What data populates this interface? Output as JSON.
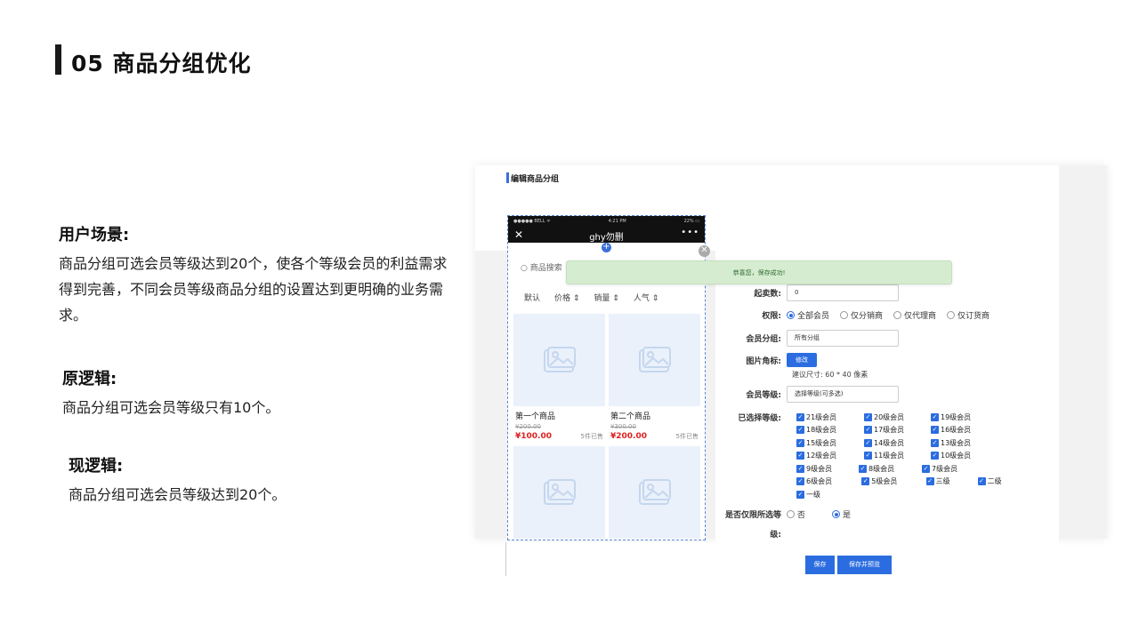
{
  "slide": {
    "title": "05 商品分组优化",
    "scene_heading": "用户场景:",
    "scene_text": "商品分组可选会员等级达到20个，使各个等级会员的利益需求得到完善，不同会员等级商品分组的设置达到更明确的业务需求。",
    "old_heading": "原逻辑:",
    "old_text": "商品分组可选会员等级只有10个。",
    "new_heading": "现逻辑:",
    "new_text": "商品分组可选会员等级达到20个。"
  },
  "panel": {
    "heading": "编辑商品分组",
    "toast": "恭喜您，保存成功!"
  },
  "phone": {
    "status_left": "●●●●● BELL ᯤ",
    "status_time": "4:21 PM",
    "status_right": "22% ▭",
    "nav_title": "ghy勿删",
    "close_glyph": "✕",
    "more_glyph": "•••",
    "search_placeholder": "商品搜索",
    "sort": [
      {
        "label": "默认"
      },
      {
        "label": "价格 ⇕"
      },
      {
        "label": "销量 ⇕"
      },
      {
        "label": "人气 ⇕"
      }
    ],
    "goods": [
      {
        "name": "第一个商品",
        "old_price": "¥200.00",
        "price": "¥100.00",
        "sold": "5件已售"
      },
      {
        "name": "第二个商品",
        "old_price": "¥300.00",
        "price": "¥200.00",
        "sold": "5件已售"
      }
    ]
  },
  "form": {
    "start_qty_label": "起卖数:",
    "start_qty_value": "0",
    "permission_label": "权限:",
    "permission_options": [
      "全部会员",
      "仅分销商",
      "仅代理商",
      "仅订货商"
    ],
    "permission_selected": "全部会员",
    "member_group_label": "会员分组:",
    "member_group_value": "所有分组",
    "badge_label": "图片角标:",
    "badge_button": "修改",
    "badge_hint": "建议尺寸: 60 * 40 像素",
    "member_level_label": "会员等级:",
    "member_level_value": "选择等级(可多选)",
    "selected_levels_label": "已选择等级:",
    "selected_levels": [
      [
        "21级会员",
        "20级会员",
        "19级会员"
      ],
      [
        "18级会员",
        "17级会员",
        "16级会员"
      ],
      [
        "15级会员",
        "14级会员",
        "13级会员"
      ],
      [
        "12级会员",
        "11级会员",
        "10级会员"
      ],
      [
        "9级会员",
        "8级会员",
        "7级会员"
      ],
      [
        "6级会员",
        "5级会员",
        "三级",
        "二级"
      ],
      [
        "一级"
      ]
    ],
    "only_selected_label_1": "是否仅限所选等",
    "only_selected_label_2": "级:",
    "only_selected_options": [
      "否",
      "是"
    ],
    "only_selected_value": "是"
  },
  "footer": {
    "save": "保存",
    "save_preview": "保存并预览"
  },
  "colors": {
    "accent": "#2b6de0",
    "toast_bg": "#d6ecd0",
    "price": "#e02020"
  }
}
